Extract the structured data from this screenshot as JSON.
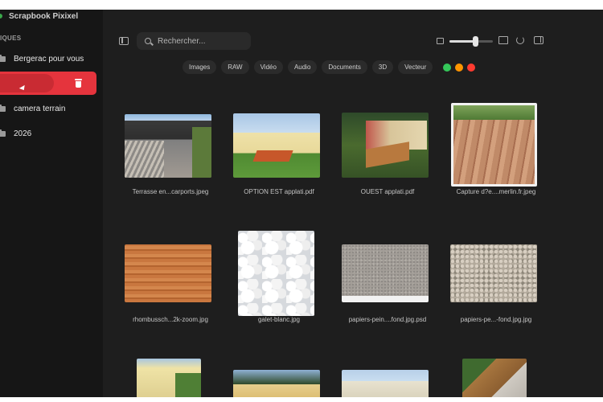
{
  "app": {
    "title": "Scrapbook Pixixel"
  },
  "sidebar": {
    "section_label": "IQUES",
    "items": [
      {
        "label": "Bergerac pour vous"
      },
      {
        "label": ""
      },
      {
        "label": "camera terrain"
      },
      {
        "label": "2026"
      }
    ]
  },
  "toolbar": {
    "search_placeholder": "Rechercher...",
    "zoom_level": 0.6
  },
  "filters": {
    "chips": [
      "Images",
      "RAW",
      "Vidéo",
      "Audio",
      "Documents",
      "3D",
      "Vecteur"
    ],
    "color_dots": [
      {
        "name": "green",
        "color": "#34c759"
      },
      {
        "name": "orange",
        "color": "#ff9500"
      },
      {
        "name": "red",
        "color": "#ff3b30"
      }
    ]
  },
  "files": [
    {
      "name": "Terrasse en...carports.jpeg"
    },
    {
      "name": "OPTION EST applati.pdf"
    },
    {
      "name": "OUEST applati.pdf"
    },
    {
      "name": "Capture d?e....merlin.fr.jpeg"
    },
    {
      "name": "rhombussch...2k-zoom.jpg"
    },
    {
      "name": "galet-blanc.jpg"
    },
    {
      "name": "papiers-pein....fond.jpg.psd"
    },
    {
      "name": "papiers-pe...-fond.jpg.jpg"
    },
    {
      "name": ""
    },
    {
      "name": ""
    },
    {
      "name": ""
    },
    {
      "name": ""
    }
  ],
  "colors": {
    "accent": "#e5343d",
    "window_bg": "#1e1e1e",
    "sidebar_bg": "#161616"
  }
}
